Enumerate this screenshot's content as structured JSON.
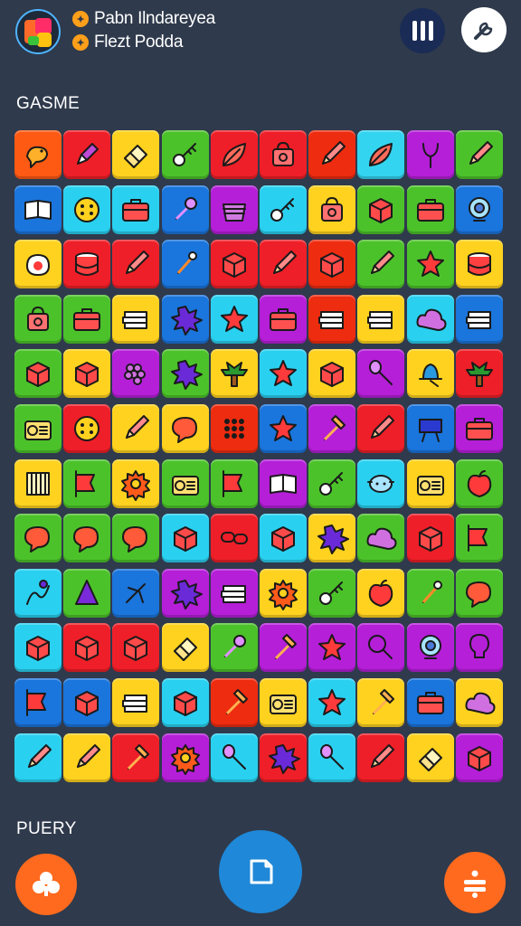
{
  "header": {
    "players": [
      {
        "name": "Pabn Ilndareyea",
        "badge_icon": "star-badge-icon"
      },
      {
        "name": "Flezt Podda",
        "badge_icon": "star-badge-icon"
      }
    ],
    "pause_icon": "pause-icon",
    "tool_icon": "wrench-icon"
  },
  "board": {
    "title": "GASME",
    "rows": [
      [
        {
          "c": "#ff5a14",
          "i": "bird"
        },
        {
          "c": "#ee1f28",
          "i": "pen"
        },
        {
          "c": "#ffd21f",
          "i": "eraser"
        },
        {
          "c": "#4cc22a",
          "i": "key"
        },
        {
          "c": "#ee1f28",
          "i": "leaf"
        },
        {
          "c": "#ee1f28",
          "i": "bag"
        },
        {
          "c": "#ee2c10",
          "i": "pencil"
        },
        {
          "c": "#33d4f0",
          "i": "leaf"
        },
        {
          "c": "#b51fd8",
          "i": "slingshot"
        },
        {
          "c": "#4cc22a",
          "i": "pencil"
        }
      ],
      [
        {
          "c": "#1a75dc",
          "i": "book"
        },
        {
          "c": "#2ad0f0",
          "i": "button"
        },
        {
          "c": "#2ad0f0",
          "i": "case"
        },
        {
          "c": "#1a75dc",
          "i": "wrench"
        },
        {
          "c": "#b51fd8",
          "i": "basket"
        },
        {
          "c": "#2ad0f0",
          "i": "key"
        },
        {
          "c": "#ffd21f",
          "i": "bag"
        },
        {
          "c": "#4cc22a",
          "i": "box"
        },
        {
          "c": "#4cc22a",
          "i": "case"
        },
        {
          "c": "#1a75dc",
          "i": "target"
        }
      ],
      [
        {
          "c": "#ffd21f",
          "i": "egg"
        },
        {
          "c": "#ee1f28",
          "i": "stack"
        },
        {
          "c": "#ee1f28",
          "i": "pencil"
        },
        {
          "c": "#1a75dc",
          "i": "pin"
        },
        {
          "c": "#ee1f28",
          "i": "box"
        },
        {
          "c": "#ee1f28",
          "i": "pencil"
        },
        {
          "c": "#ee2c10",
          "i": "box"
        },
        {
          "c": "#4cc22a",
          "i": "pencil"
        },
        {
          "c": "#4cc22a",
          "i": "star"
        },
        {
          "c": "#ffd21f",
          "i": "stack"
        }
      ],
      [
        {
          "c": "#4cc22a",
          "i": "bag"
        },
        {
          "c": "#4cc22a",
          "i": "case"
        },
        {
          "c": "#ffd21f",
          "i": "books"
        },
        {
          "c": "#1a75dc",
          "i": "splat"
        },
        {
          "c": "#2ad0f0",
          "i": "star"
        },
        {
          "c": "#b51fd8",
          "i": "case"
        },
        {
          "c": "#ee2c10",
          "i": "books"
        },
        {
          "c": "#ffd21f",
          "i": "books"
        },
        {
          "c": "#2ad0f0",
          "i": "cloud"
        },
        {
          "c": "#1a75dc",
          "i": "books"
        }
      ],
      [
        {
          "c": "#4cc22a",
          "i": "box"
        },
        {
          "c": "#ffd21f",
          "i": "box"
        },
        {
          "c": "#b51fd8",
          "i": "grapes"
        },
        {
          "c": "#4cc22a",
          "i": "splat"
        },
        {
          "c": "#ffd21f",
          "i": "tree"
        },
        {
          "c": "#2ad0f0",
          "i": "star"
        },
        {
          "c": "#ffd21f",
          "i": "box"
        },
        {
          "c": "#b51fd8",
          "i": "spoon"
        },
        {
          "c": "#ffd21f",
          "i": "bell"
        },
        {
          "c": "#ee1f28",
          "i": "tree"
        }
      ],
      [
        {
          "c": "#4cc22a",
          "i": "radio"
        },
        {
          "c": "#ee1f28",
          "i": "button"
        },
        {
          "c": "#ffd21f",
          "i": "pencil"
        },
        {
          "c": "#ffd21f",
          "i": "chat"
        },
        {
          "c": "#ee2c10",
          "i": "grid"
        },
        {
          "c": "#1a75dc",
          "i": "star"
        },
        {
          "c": "#b51fd8",
          "i": "hammer"
        },
        {
          "c": "#ee1f28",
          "i": "pencil"
        },
        {
          "c": "#1a75dc",
          "i": "sign"
        },
        {
          "c": "#b51fd8",
          "i": "case"
        }
      ],
      [
        {
          "c": "#ffd21f",
          "i": "bars"
        },
        {
          "c": "#4cc22a",
          "i": "flag"
        },
        {
          "c": "#ffd21f",
          "i": "gear"
        },
        {
          "c": "#4cc22a",
          "i": "radio"
        },
        {
          "c": "#4cc22a",
          "i": "flag"
        },
        {
          "c": "#b51fd8",
          "i": "book"
        },
        {
          "c": "#4cc22a",
          "i": "key"
        },
        {
          "c": "#2ad0f0",
          "i": "pot"
        },
        {
          "c": "#ffd21f",
          "i": "radio"
        },
        {
          "c": "#4cc22a",
          "i": "apple"
        }
      ],
      [
        {
          "c": "#4cc22a",
          "i": "chat"
        },
        {
          "c": "#4cc22a",
          "i": "chat"
        },
        {
          "c": "#4cc22a",
          "i": "chat"
        },
        {
          "c": "#2ad0f0",
          "i": "box"
        },
        {
          "c": "#ee1f28",
          "i": "link"
        },
        {
          "c": "#2ad0f0",
          "i": "box"
        },
        {
          "c": "#ffd21f",
          "i": "splat"
        },
        {
          "c": "#4cc22a",
          "i": "cloud"
        },
        {
          "c": "#ee1f28",
          "i": "box"
        },
        {
          "c": "#4cc22a",
          "i": "flag"
        }
      ],
      [
        {
          "c": "#2ad0f0",
          "i": "figure"
        },
        {
          "c": "#4cc22a",
          "i": "cone"
        },
        {
          "c": "#1a75dc",
          "i": "cross"
        },
        {
          "c": "#b51fd8",
          "i": "splat"
        },
        {
          "c": "#b51fd8",
          "i": "books"
        },
        {
          "c": "#ffd21f",
          "i": "gear"
        },
        {
          "c": "#4cc22a",
          "i": "key"
        },
        {
          "c": "#ffd21f",
          "i": "apple"
        },
        {
          "c": "#4cc22a",
          "i": "pin"
        },
        {
          "c": "#4cc22a",
          "i": "chat"
        }
      ],
      [
        {
          "c": "#2ad0f0",
          "i": "box"
        },
        {
          "c": "#ee1f28",
          "i": "box"
        },
        {
          "c": "#ee1f28",
          "i": "box"
        },
        {
          "c": "#ffd21f",
          "i": "eraser"
        },
        {
          "c": "#4cc22a",
          "i": "wrench"
        },
        {
          "c": "#b51fd8",
          "i": "hammer"
        },
        {
          "c": "#b51fd8",
          "i": "star"
        },
        {
          "c": "#b51fd8",
          "i": "search"
        },
        {
          "c": "#b51fd8",
          "i": "target"
        },
        {
          "c": "#b51fd8",
          "i": "bulb"
        }
      ],
      [
        {
          "c": "#1a75dc",
          "i": "flag"
        },
        {
          "c": "#1a75dc",
          "i": "box"
        },
        {
          "c": "#ffd21f",
          "i": "books"
        },
        {
          "c": "#2ad0f0",
          "i": "box"
        },
        {
          "c": "#ee2c10",
          "i": "hammer"
        },
        {
          "c": "#ffd21f",
          "i": "radio"
        },
        {
          "c": "#2ad0f0",
          "i": "star"
        },
        {
          "c": "#ffd21f",
          "i": "hammer"
        },
        {
          "c": "#1a75dc",
          "i": "case"
        },
        {
          "c": "#ffd21f",
          "i": "cloud"
        }
      ],
      [
        {
          "c": "#2ad0f0",
          "i": "pencil"
        },
        {
          "c": "#ffd21f",
          "i": "pencil"
        },
        {
          "c": "#ee1f28",
          "i": "hammer"
        },
        {
          "c": "#b51fd8",
          "i": "gear"
        },
        {
          "c": "#2ad0f0",
          "i": "spoon"
        },
        {
          "c": "#ee1f28",
          "i": "splat"
        },
        {
          "c": "#2ad0f0",
          "i": "spoon"
        },
        {
          "c": "#ee1f28",
          "i": "pencil"
        },
        {
          "c": "#ffd21f",
          "i": "eraser"
        },
        {
          "c": "#b51fd8",
          "i": "box"
        }
      ]
    ]
  },
  "pool": {
    "title": "PUERY",
    "left_icon": "club-icon",
    "center_icon": "card-icon",
    "right_icon": "divide-icon"
  }
}
